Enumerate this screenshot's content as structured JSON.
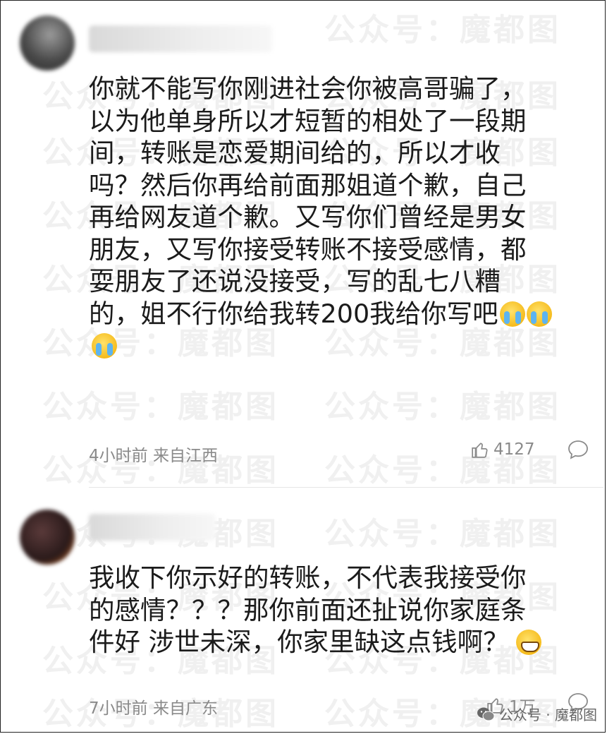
{
  "watermark": {
    "text": "公众号：魔都图"
  },
  "comments": [
    {
      "body": "你就不能写你刚进社会你被高哥骗了，\n以为他单身所以才短暂的相处了一段期\n间，转账是恋爱期间给的，所以才收\n吗？然后你再给前面那姐道个歉，自己\n再给网友道个歉。又写你们曾经是男女\n朋友，又写你接受转账不接受感情，都\n耍朋友了还说没接受，写的乱七八糟\n的，姐不行你给我转200我给你写吧",
      "emoji_trail_line": [
        "crying-face",
        "crying-face"
      ],
      "emoji_extra_line": [
        "crying-face"
      ],
      "time": "4小时前",
      "location": "来自江西",
      "likes": "4127"
    },
    {
      "body": "我收下你示好的转账，不代表我接受你\n的感情？？？那你前面还扯说你家庭条\n件好 涉世未深，你家里缺这点钱啊？",
      "emoji_trail_line": [
        "grinning-face"
      ],
      "time": "7小时前",
      "location": "来自广东",
      "likes": "1万"
    }
  ],
  "badge": {
    "label": "公众号 · 魔都图"
  },
  "colors": {
    "text": "#1b1b1b",
    "meta": "#8a8a8a",
    "divider": "#e6e6e6"
  }
}
